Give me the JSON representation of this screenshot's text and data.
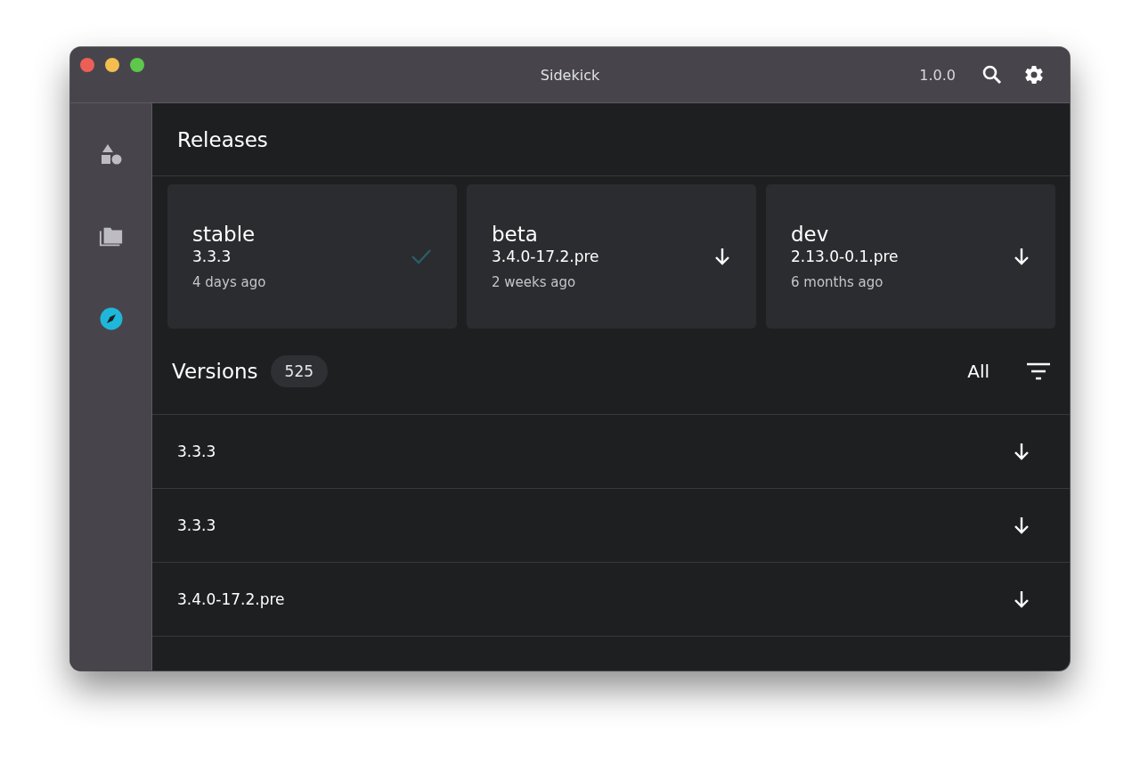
{
  "window": {
    "title": "Sidekick",
    "version": "1.0.0"
  },
  "sidebar": {
    "items": [
      {
        "kind": "shapes",
        "selected": false
      },
      {
        "kind": "folders",
        "selected": false
      },
      {
        "kind": "compass",
        "selected": true
      }
    ]
  },
  "releases": {
    "title": "Releases",
    "cards": [
      {
        "channel": "stable",
        "version": "3.3.3",
        "age": "4 days ago",
        "installed": true
      },
      {
        "channel": "beta",
        "version": "3.4.0-17.2.pre",
        "age": "2 weeks ago",
        "installed": false
      },
      {
        "channel": "dev",
        "version": "2.13.0-0.1.pre",
        "age": "6 months ago",
        "installed": false
      }
    ]
  },
  "versions": {
    "title": "Versions",
    "count": "525",
    "filter": "All",
    "rows": [
      {
        "version": "3.3.3"
      },
      {
        "version": "3.3.3"
      },
      {
        "version": "3.4.0-17.2.pre"
      }
    ]
  }
}
